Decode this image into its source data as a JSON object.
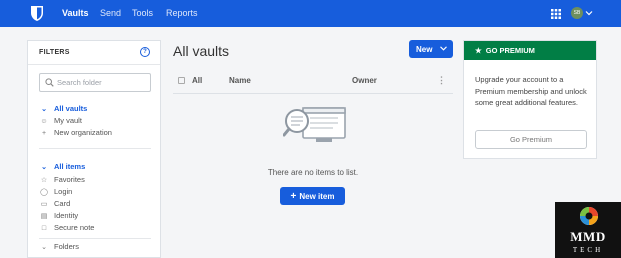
{
  "topnav": {
    "items": [
      {
        "label": "Vaults"
      },
      {
        "label": "Send"
      },
      {
        "label": "Tools"
      },
      {
        "label": "Reports"
      }
    ],
    "avatar_initials": "SB",
    "bg_color": "#175ddc"
  },
  "filters": {
    "title": "FILTERS",
    "search_placeholder": "Search folder",
    "vaults_group": [
      {
        "label": "All vaults",
        "icon": "chevron-down-icon",
        "active": true
      },
      {
        "label": "My vault",
        "icon": "user-icon"
      },
      {
        "label": "New organization",
        "icon": "plus-icon"
      }
    ],
    "items_group": [
      {
        "label": "All items",
        "icon": "chevron-down-icon",
        "active": true
      },
      {
        "label": "Favorites",
        "icon": "star-icon"
      },
      {
        "label": "Login",
        "icon": "globe-icon"
      },
      {
        "label": "Card",
        "icon": "credit-card-icon"
      },
      {
        "label": "Identity",
        "icon": "id-card-icon"
      },
      {
        "label": "Secure note",
        "icon": "sticky-note-icon"
      }
    ],
    "folders_label": "Folders"
  },
  "main": {
    "title": "All vaults",
    "new_button": "New",
    "columns": {
      "all": "All",
      "name": "Name",
      "owner": "Owner"
    },
    "empty_text": "There are no items to list.",
    "new_item_button": "New item"
  },
  "premium": {
    "header": "GO PREMIUM",
    "body": "Upgrade your account to a Premium membership and unlock some great additional features.",
    "button": "Go Premium",
    "header_color": "#017e45"
  },
  "watermark": {
    "line1": "MMD",
    "line2": "TECH"
  }
}
